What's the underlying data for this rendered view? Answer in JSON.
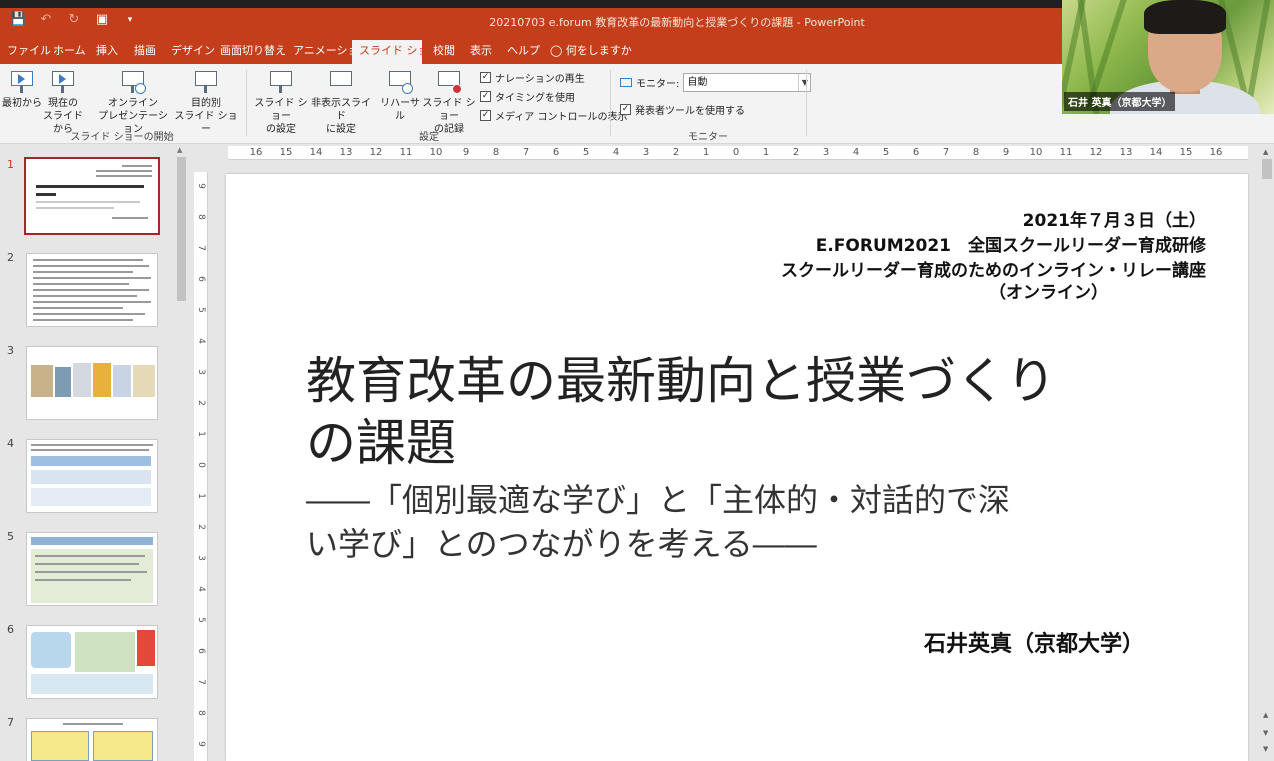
{
  "window": {
    "title": "20210703  e.forum  教育改革の最新動向と授業づくりの課題  -  PowerPoint"
  },
  "quick_access": {
    "icons": [
      "save-icon",
      "undo-icon",
      "redo-icon",
      "present-icon",
      "customize-icon"
    ]
  },
  "tabs": [
    {
      "label": "ファイル"
    },
    {
      "label": "ホーム"
    },
    {
      "label": "挿入"
    },
    {
      "label": "描画"
    },
    {
      "label": "デザイン"
    },
    {
      "label": "画面切り替え"
    },
    {
      "label": "アニメーション"
    },
    {
      "label": "スライド ショー",
      "active": true
    },
    {
      "label": "校閲"
    },
    {
      "label": "表示"
    },
    {
      "label": "ヘルプ"
    },
    {
      "label": "何をしますか"
    }
  ],
  "ribbon": {
    "start": {
      "from_beginning": "最初から",
      "from_current_1": "現在の",
      "from_current_2": "スライドから",
      "online_1": "オンライン",
      "online_2": "プレゼンテーション",
      "custom_1": "目的別",
      "custom_2": "スライド ショー",
      "group_label": "スライド ショーの開始"
    },
    "setup": {
      "setup_1": "スライド ショー",
      "setup_2": "の設定",
      "hide_1": "非表示スライド",
      "hide_2": "に設定",
      "rehearse": "リハーサル",
      "record_1": "スライド ショー",
      "record_2": "の記録",
      "chk_narration": "ナレーションの再生",
      "chk_timing": "タイミングを使用",
      "chk_media": "メディア コントロールの表示",
      "group_label": "設定"
    },
    "monitor": {
      "monitor_label": "モニター:",
      "monitor_value": "自動",
      "presenter_view": "発表者ツールを使用する",
      "group_label": "モニター"
    }
  },
  "webcam": {
    "name": "石井 英真（京都大学）"
  },
  "thumbnails": [
    {
      "num": "1",
      "active": true
    },
    {
      "num": "2"
    },
    {
      "num": "3"
    },
    {
      "num": "4"
    },
    {
      "num": "5"
    },
    {
      "num": "6"
    },
    {
      "num": "7"
    }
  ],
  "ruler": {
    "h": [
      "16",
      "15",
      "14",
      "13",
      "12",
      "11",
      "10",
      "9",
      "8",
      "7",
      "6",
      "5",
      "4",
      "3",
      "2",
      "1",
      "0",
      "1",
      "2",
      "3",
      "4",
      "5",
      "6",
      "7",
      "8",
      "9",
      "10",
      "11",
      "12",
      "13",
      "14",
      "15",
      "16"
    ],
    "v": [
      "9",
      "8",
      "7",
      "6",
      "5",
      "4",
      "3",
      "2",
      "1",
      "0",
      "1",
      "2",
      "3",
      "4",
      "5",
      "6",
      "7",
      "8",
      "9"
    ]
  },
  "slide": {
    "date": "2021年７月３日（土）",
    "event": "E.FORUM2021　全国スクールリーダー育成研修",
    "course": "スクールリーダー育成のためのインライン・リレー講座",
    "mode": "（オンライン）",
    "title_1": "教育改革の最新動向と授業づくり",
    "title_2": "の課題",
    "subtitle_1": "――「個別最適な学び」と「主体的・対話的で深",
    "subtitle_2": "い学び」とのつながりを考える――",
    "author": "石井英真（京都大学）"
  },
  "colors": {
    "brand": "#c43e1c",
    "ribbon_bg": "#f3f3f3",
    "thumb_active_border": "#a4262c"
  }
}
